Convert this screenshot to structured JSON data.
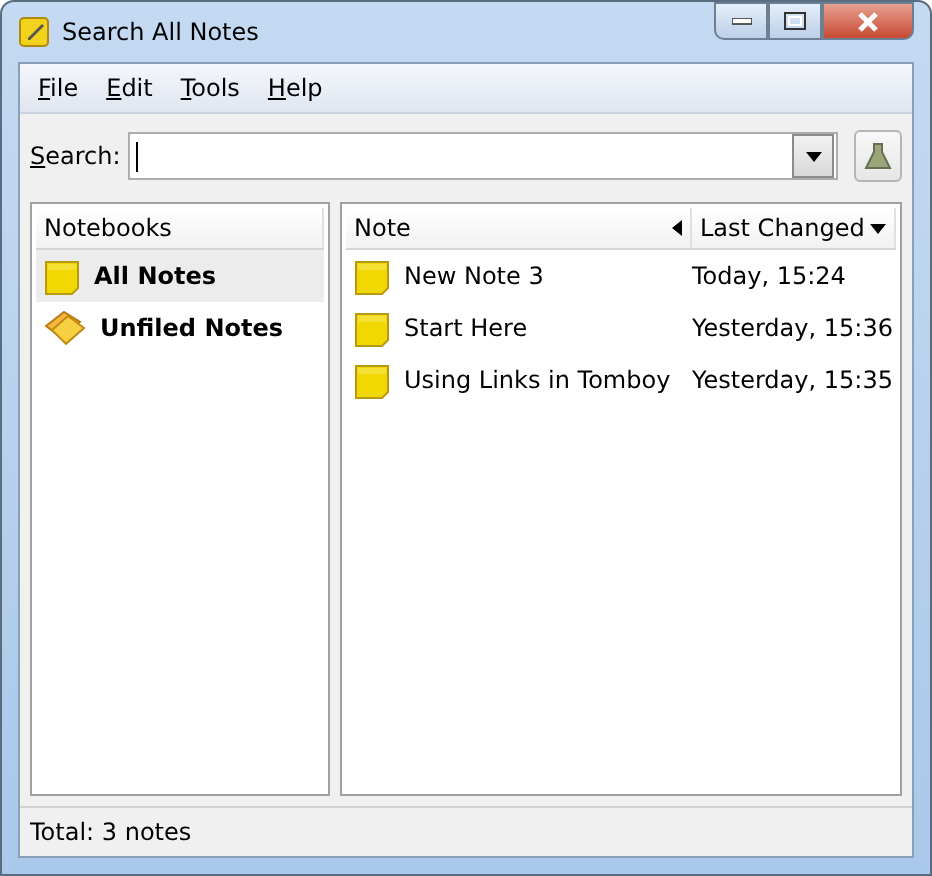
{
  "window": {
    "title": "Search All Notes"
  },
  "menu": [
    {
      "label": "File"
    },
    {
      "label": "Edit"
    },
    {
      "label": "Tools"
    },
    {
      "label": "Help"
    }
  ],
  "search": {
    "label": "Search:"
  },
  "notebooks": {
    "header": "Notebooks",
    "items": [
      {
        "label": "All Notes",
        "kind": "all",
        "selected": true
      },
      {
        "label": "Unfiled Notes",
        "kind": "unfiled",
        "selected": false
      }
    ]
  },
  "notes": {
    "columns": [
      "Note",
      "Last Changed"
    ],
    "rows": [
      {
        "title": "New Note 3",
        "changed": "Today, 15:24",
        "selected": false
      },
      {
        "title": "Start Here",
        "changed": "Yesterday, 15:36",
        "selected": false
      },
      {
        "title": "Using Links in Tomboy",
        "changed": "Yesterday, 15:35",
        "selected": false
      }
    ]
  },
  "status_bar": "Total: 3 notes"
}
